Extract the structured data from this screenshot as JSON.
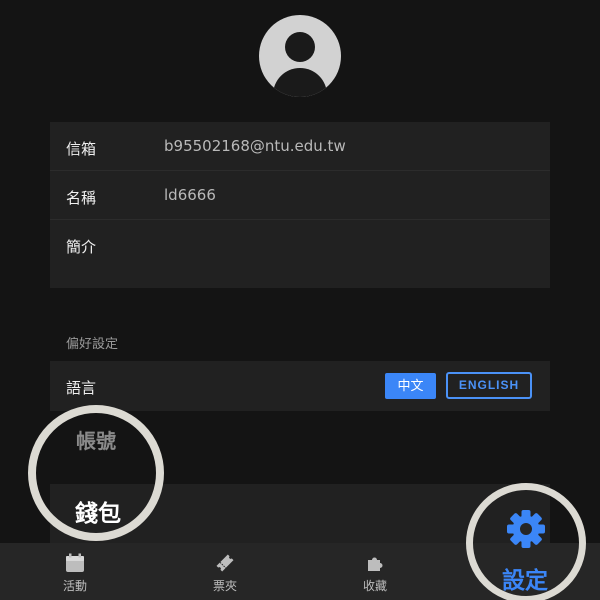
{
  "profile": {
    "email_label": "信箱",
    "email_value": "b95502168@ntu.edu.tw",
    "name_label": "名稱",
    "name_value": "ld6666",
    "bio_label": "簡介",
    "bio_value": ""
  },
  "preferences": {
    "section_title": "偏好設定",
    "language_label": "語言",
    "language_options": [
      "中文",
      "ENGLISH"
    ],
    "language_selected": "中文"
  },
  "account": {
    "account_label": "帳號",
    "wallet_label": "錢包"
  },
  "nav": {
    "items": [
      {
        "label": "活動",
        "icon": "calendar-icon"
      },
      {
        "label": "票夾",
        "icon": "ticket-icon"
      },
      {
        "label": "收藏",
        "icon": "puzzle-icon"
      },
      {
        "label": "設定",
        "icon": "gear-icon"
      }
    ],
    "active": "設定"
  },
  "colors": {
    "background": "#141414",
    "card": "#212121",
    "accent": "#3b86f7",
    "highlight_ring": "#dcdad3"
  }
}
